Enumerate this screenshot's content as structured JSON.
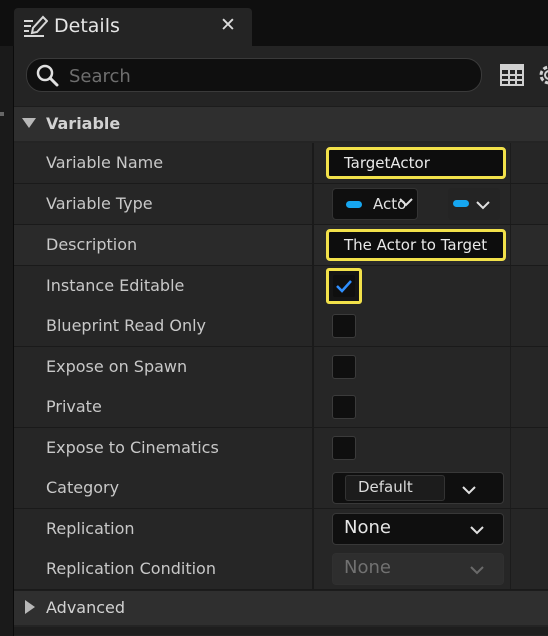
{
  "tab": {
    "title": "Details",
    "close_glyph": "✕",
    "icon": "pencil-details-icon"
  },
  "search": {
    "placeholder": "Search",
    "value": ""
  },
  "toolbar": {
    "icons": [
      "property-matrix-icon",
      "gear-icon"
    ]
  },
  "sections": {
    "variable": {
      "label": "Variable",
      "expanded": true
    },
    "advanced": {
      "label": "Advanced",
      "expanded": false
    }
  },
  "properties": {
    "variable_name": {
      "label": "Variable Name",
      "value": "TargetActor"
    },
    "variable_type": {
      "label": "Variable Type",
      "value": "Acto",
      "pin_color": "#16a6f0"
    },
    "description": {
      "label": "Description",
      "value": "The Actor to Target"
    },
    "instance_editable": {
      "label": "Instance Editable",
      "checked": true
    },
    "blueprint_read_only": {
      "label": "Blueprint Read Only",
      "checked": false
    },
    "expose_on_spawn": {
      "label": "Expose on Spawn",
      "checked": false
    },
    "private": {
      "label": "Private",
      "checked": false
    },
    "expose_to_cinematics": {
      "label": "Expose to Cinematics",
      "checked": false
    },
    "category": {
      "label": "Category",
      "value": "Default"
    },
    "replication": {
      "label": "Replication",
      "value": "None"
    },
    "replication_condition": {
      "label": "Replication Condition",
      "value": "None",
      "enabled": false
    }
  },
  "colors": {
    "highlight": "#f2e14a",
    "check": "#2f8fff",
    "panel": "#242424"
  }
}
